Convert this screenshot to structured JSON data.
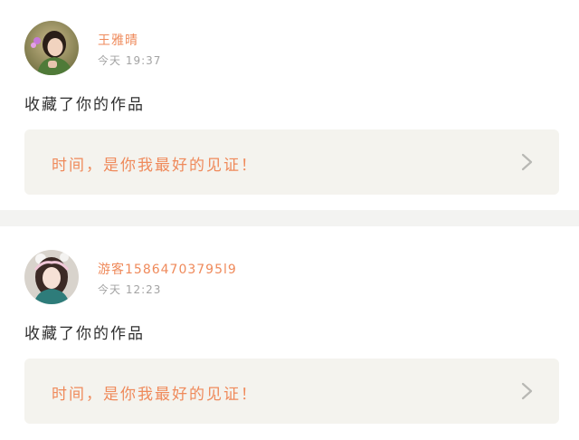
{
  "feed": {
    "items": [
      {
        "username": "王雅晴",
        "time": "今天 19:37",
        "action": "收藏了你的作品",
        "work_title": "时间，是你我最好的见证！",
        "avatar_icon": "user-avatar-photo"
      },
      {
        "username": "游客15864703795l9",
        "time": "今天 12:23",
        "action": "收藏了你的作品",
        "work_title": "时间，是你我最好的见证！",
        "avatar_icon": "user-avatar-photo"
      }
    ]
  },
  "colors": {
    "accent": "#ef8a5b",
    "box_bg": "#f4f3ee",
    "divider": "#f3f3f1",
    "text": "#2f2f2f",
    "muted": "#a3a3a3"
  }
}
